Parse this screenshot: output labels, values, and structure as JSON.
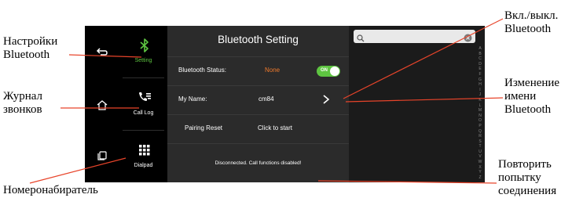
{
  "callouts": {
    "bt_settings": [
      "Настройки",
      "Bluetooth"
    ],
    "call_log": [
      "Журнал",
      "звонков"
    ],
    "dialer": [
      "Номеронабиратель"
    ],
    "bt_toggle": [
      "Вкл./выкл.",
      "Bluetooth"
    ],
    "rename": [
      "Изменение",
      "имени",
      "Bluetooth"
    ],
    "retry": [
      "Повторить",
      "попытку",
      "соединения"
    ]
  },
  "nav": {
    "setting_label": "Setting",
    "calllog_label": "Call Log",
    "dialpad_label": "Dialpad"
  },
  "settings": {
    "title": "Bluetooth Setting",
    "status_label": "Bluetooth Status:",
    "status_value": "None",
    "toggle_label": "ON",
    "name_label": "My Name:",
    "name_value": "cm84",
    "pairing_label": "Pairing Reset",
    "pairing_action": "Click to start",
    "message": "Disconnected. Call functions disabled!"
  },
  "search": {
    "placeholder": ""
  },
  "alphabet": [
    "A",
    "B",
    "C",
    "D",
    "E",
    "F",
    "G",
    "H",
    "I",
    "J",
    "K",
    "L",
    "M",
    "N",
    "O",
    "P",
    "Q",
    "R",
    "S",
    "T",
    "U",
    "V",
    "W",
    "X",
    "Y",
    "Z"
  ],
  "colors": {
    "accent_green": "#5ec541",
    "status_orange": "#ef7a2c",
    "callout_line": "#e8442a"
  },
  "icons": {
    "back": "back-arrow-icon",
    "home": "home-icon",
    "recent": "recent-apps-icon",
    "bluetooth": "bluetooth-icon",
    "calllog": "call-log-icon",
    "dialpad": "dialpad-icon",
    "search": "search-icon",
    "clear": "clear-icon",
    "chevron": "chevron-right-icon"
  }
}
